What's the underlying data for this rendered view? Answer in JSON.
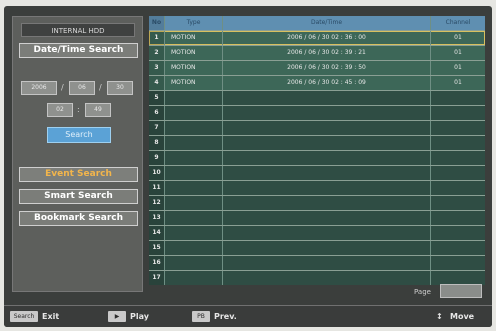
{
  "sidebar": {
    "title": "INTERNAL HDD",
    "date_time_search_label": "Date/Time Search",
    "date_fields": [
      "2006",
      "06",
      "30"
    ],
    "time_fields": [
      "02",
      "49"
    ],
    "search_label": "Search",
    "event_search_label": "Event Search",
    "smart_search_label": "Smart Search",
    "bookmark_search_label": "Bookmark Search"
  },
  "table": {
    "headers": {
      "no": "No",
      "type": "Type",
      "datetime": "Date/Time",
      "channel": "Channel"
    },
    "rows": [
      {
        "no": "1",
        "type": "MOTION",
        "datetime": "2006 / 06 / 30  02 : 36 : 00",
        "channel": "01"
      },
      {
        "no": "2",
        "type": "MOTION",
        "datetime": "2006 / 06 / 30  02 : 39 : 21",
        "channel": "01"
      },
      {
        "no": "3",
        "type": "MOTION",
        "datetime": "2006 / 06 / 30  02 : 39 : 50",
        "channel": "01"
      },
      {
        "no": "4",
        "type": "MOTION",
        "datetime": "2006 / 06 / 30  02 : 45 : 09",
        "channel": "01"
      },
      {
        "no": "5",
        "type": "",
        "datetime": "",
        "channel": ""
      },
      {
        "no": "6",
        "type": "",
        "datetime": "",
        "channel": ""
      },
      {
        "no": "7",
        "type": "",
        "datetime": "",
        "channel": ""
      },
      {
        "no": "8",
        "type": "",
        "datetime": "",
        "channel": ""
      },
      {
        "no": "9",
        "type": "",
        "datetime": "",
        "channel": ""
      },
      {
        "no": "10",
        "type": "",
        "datetime": "",
        "channel": ""
      },
      {
        "no": "11",
        "type": "",
        "datetime": "",
        "channel": ""
      },
      {
        "no": "12",
        "type": "",
        "datetime": "",
        "channel": ""
      },
      {
        "no": "13",
        "type": "",
        "datetime": "",
        "channel": ""
      },
      {
        "no": "14",
        "type": "",
        "datetime": "",
        "channel": ""
      },
      {
        "no": "15",
        "type": "",
        "datetime": "",
        "channel": ""
      },
      {
        "no": "16",
        "type": "",
        "datetime": "",
        "channel": ""
      },
      {
        "no": "17",
        "type": "",
        "datetime": "",
        "channel": ""
      }
    ]
  },
  "pagination": {
    "label": "Page",
    "value": ""
  },
  "footer": {
    "exit_key": "Search",
    "exit_label": "Exit",
    "play_key": "▶",
    "play_label": "Play",
    "prev_key": "PB",
    "prev_label": "Prev.",
    "move_icon": "↕",
    "move_label": "Move"
  },
  "colors": {
    "highlight_text": "#f2b54b",
    "search_button": "#5ba2d6",
    "header_row": "#5f8fb1",
    "data_row": "#3d6758"
  }
}
